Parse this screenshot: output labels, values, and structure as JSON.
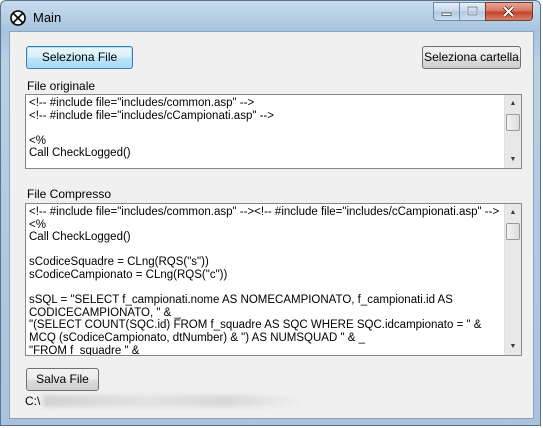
{
  "window": {
    "title": "Main",
    "icon": "no-entry-circle-icon",
    "controls": {
      "minimize": "minimize-icon",
      "maximize": "maximize-icon",
      "close": "close-icon"
    }
  },
  "toolbar": {
    "select_file_label": "Seleziona File",
    "select_folder_label": "Seleziona cartella"
  },
  "original": {
    "label": "File originale",
    "content": "<!-- #include file=\"includes/common.asp\" -->\n<!-- #include file=\"includes/cCampionati.asp\" -->\n\n<%\nCall CheckLogged()"
  },
  "compressed": {
    "label": "File Compresso",
    "content": "<!-- #include file=\"includes/common.asp\" --><!-- #include file=\"includes/cCampionati.asp\" --><%\nCall CheckLogged()\n\nsCodiceSquadre = CLng(RQS(\"s\"))\nsCodiceCampionato = CLng(RQS(\"c\"))\n\nsSQL = \"SELECT f_campionati.nome AS NOMECAMPIONATO, f_campionati.id AS CODICECAMPIONATO, \" & _\n\"(SELECT COUNT(SQC.id) FROM f_squadre AS SQC WHERE SQC.idcampionato = \" & MCQ (sCodiceCampionato, dtNumber) & \") AS NUMSQUAD \" & _\n\"FROM f_squadre \" & _"
  },
  "footer": {
    "save_label": "Salva File",
    "path_prefix": "C:\\"
  },
  "colors": {
    "window_frame": "#a9c3dc",
    "close_button": "#c1452b",
    "focused_button_border": "#3c7fb1"
  }
}
